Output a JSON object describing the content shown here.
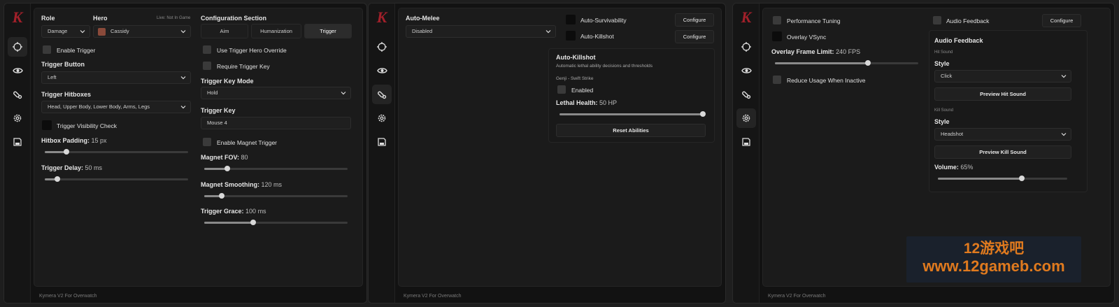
{
  "app": {
    "logo_letter": "K",
    "footer": "Kymera V2 For Overwatch",
    "accent": "#a2202a"
  },
  "nav": [
    "crosshair-icon",
    "eye-icon",
    "pill-icon",
    "gear-icon",
    "save-icon"
  ],
  "panel1": {
    "role_label": "Role",
    "role_value": "Damage",
    "hero_label": "Hero",
    "hero_status": "Live: Not In Game",
    "hero_value": "Cassidy",
    "enable_trigger": "Enable Trigger",
    "trigger_button_label": "Trigger Button",
    "trigger_button_value": "Left",
    "hitboxes_label": "Trigger Hitboxes",
    "hitboxes_value": "Head, Upper Body, Lower Body, Arms, Legs",
    "visibility_check": "Trigger Visibility Check",
    "hitbox_padding_label": "Hitbox Padding:",
    "hitbox_padding_value": "15 px",
    "hitbox_padding_fraction": 0.15,
    "trigger_delay_label": "Trigger Delay:",
    "trigger_delay_value": "50 ms",
    "trigger_delay_fraction": 0.09,
    "config_title": "Configuration Section",
    "tabs": [
      "Aim",
      "Humanization",
      "Trigger"
    ],
    "use_override": "Use Trigger Hero Override",
    "require_key": "Require Trigger Key",
    "key_mode_label": "Trigger Key Mode",
    "key_mode_value": "Hold",
    "trigger_key_label": "Trigger Key",
    "trigger_key_value": "Mouse 4",
    "enable_magnet": "Enable Magnet Trigger",
    "magnet_fov_label": "Magnet FOV:",
    "magnet_fov_value": "80",
    "magnet_fov_fraction": 0.16,
    "magnet_smoothing_label": "Magnet Smoothing:",
    "magnet_smoothing_value": "120 ms",
    "magnet_smoothing_fraction": 0.12,
    "trigger_grace_label": "Trigger Grace:",
    "trigger_grace_value": "100 ms",
    "trigger_grace_fraction": 0.34
  },
  "panel2": {
    "auto_melee_label": "Auto-Melee",
    "auto_melee_value": "Disabled",
    "auto_survivability": "Auto-Survivability",
    "auto_killshot": "Auto-Killshot",
    "configure": "Configure",
    "card_title": "Auto-Killshot",
    "card_subtitle": "Automatic lethal ability decisions and thresholds",
    "ability_name": "Genji - Swift Strike",
    "enabled": "Enabled",
    "lethal_label": "Lethal Health:",
    "lethal_value": "50 HP",
    "lethal_fraction": 1.0,
    "reset": "Reset Abilities"
  },
  "panel3": {
    "performance_tuning": "Performance Tuning",
    "overlay_vsync": "Overlay VSync",
    "frame_limit_label": "Overlay Frame Limit:",
    "frame_limit_value": "240 FPS",
    "frame_limit_fraction": 0.65,
    "reduce_usage": "Reduce Usage When Inactive",
    "audio_feedback": "Audio Feedback",
    "configure": "Configure",
    "card_title": "Audio Feedback",
    "hit_sound_label": "Hit Sound",
    "style_label": "Style",
    "hit_style_value": "Click",
    "preview_hit": "Preview Hit Sound",
    "kill_sound_label": "Kill Sound",
    "kill_style_value": "Headshot",
    "preview_kill": "Preview Kill Sound",
    "volume_label": "Volume:",
    "volume_value": "65%",
    "volume_fraction": 0.65
  },
  "watermark": {
    "line1": "12游戏吧",
    "line2": "www.12gameb.com",
    "color": "#e07a1e"
  }
}
